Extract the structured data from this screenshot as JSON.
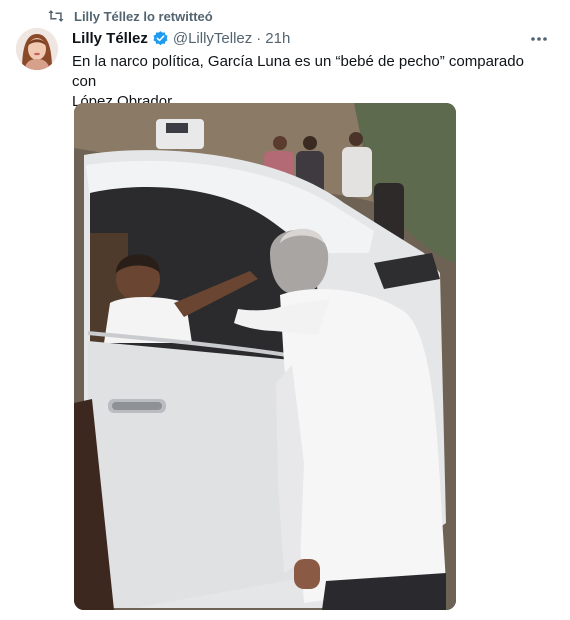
{
  "retweet": {
    "icon": "retweet-icon",
    "label": "Lilly Téllez lo retwitteó"
  },
  "tweet": {
    "display_name": "Lilly Téllez",
    "verified_icon": "verified-badge-icon",
    "handle": "@LillyTellez",
    "separator": "·",
    "time": "21h",
    "more_icon": "more-options-icon",
    "text_line1": "En la narco política, García Luna es un “bebé de pecho” comparado con",
    "text_line2": "López Obrador.",
    "media": {
      "type": "video-still"
    }
  },
  "colors": {
    "text_primary": "#0f1419",
    "text_secondary": "#536471",
    "verified_blue": "#1d9bf0",
    "media_background": "#000000"
  }
}
